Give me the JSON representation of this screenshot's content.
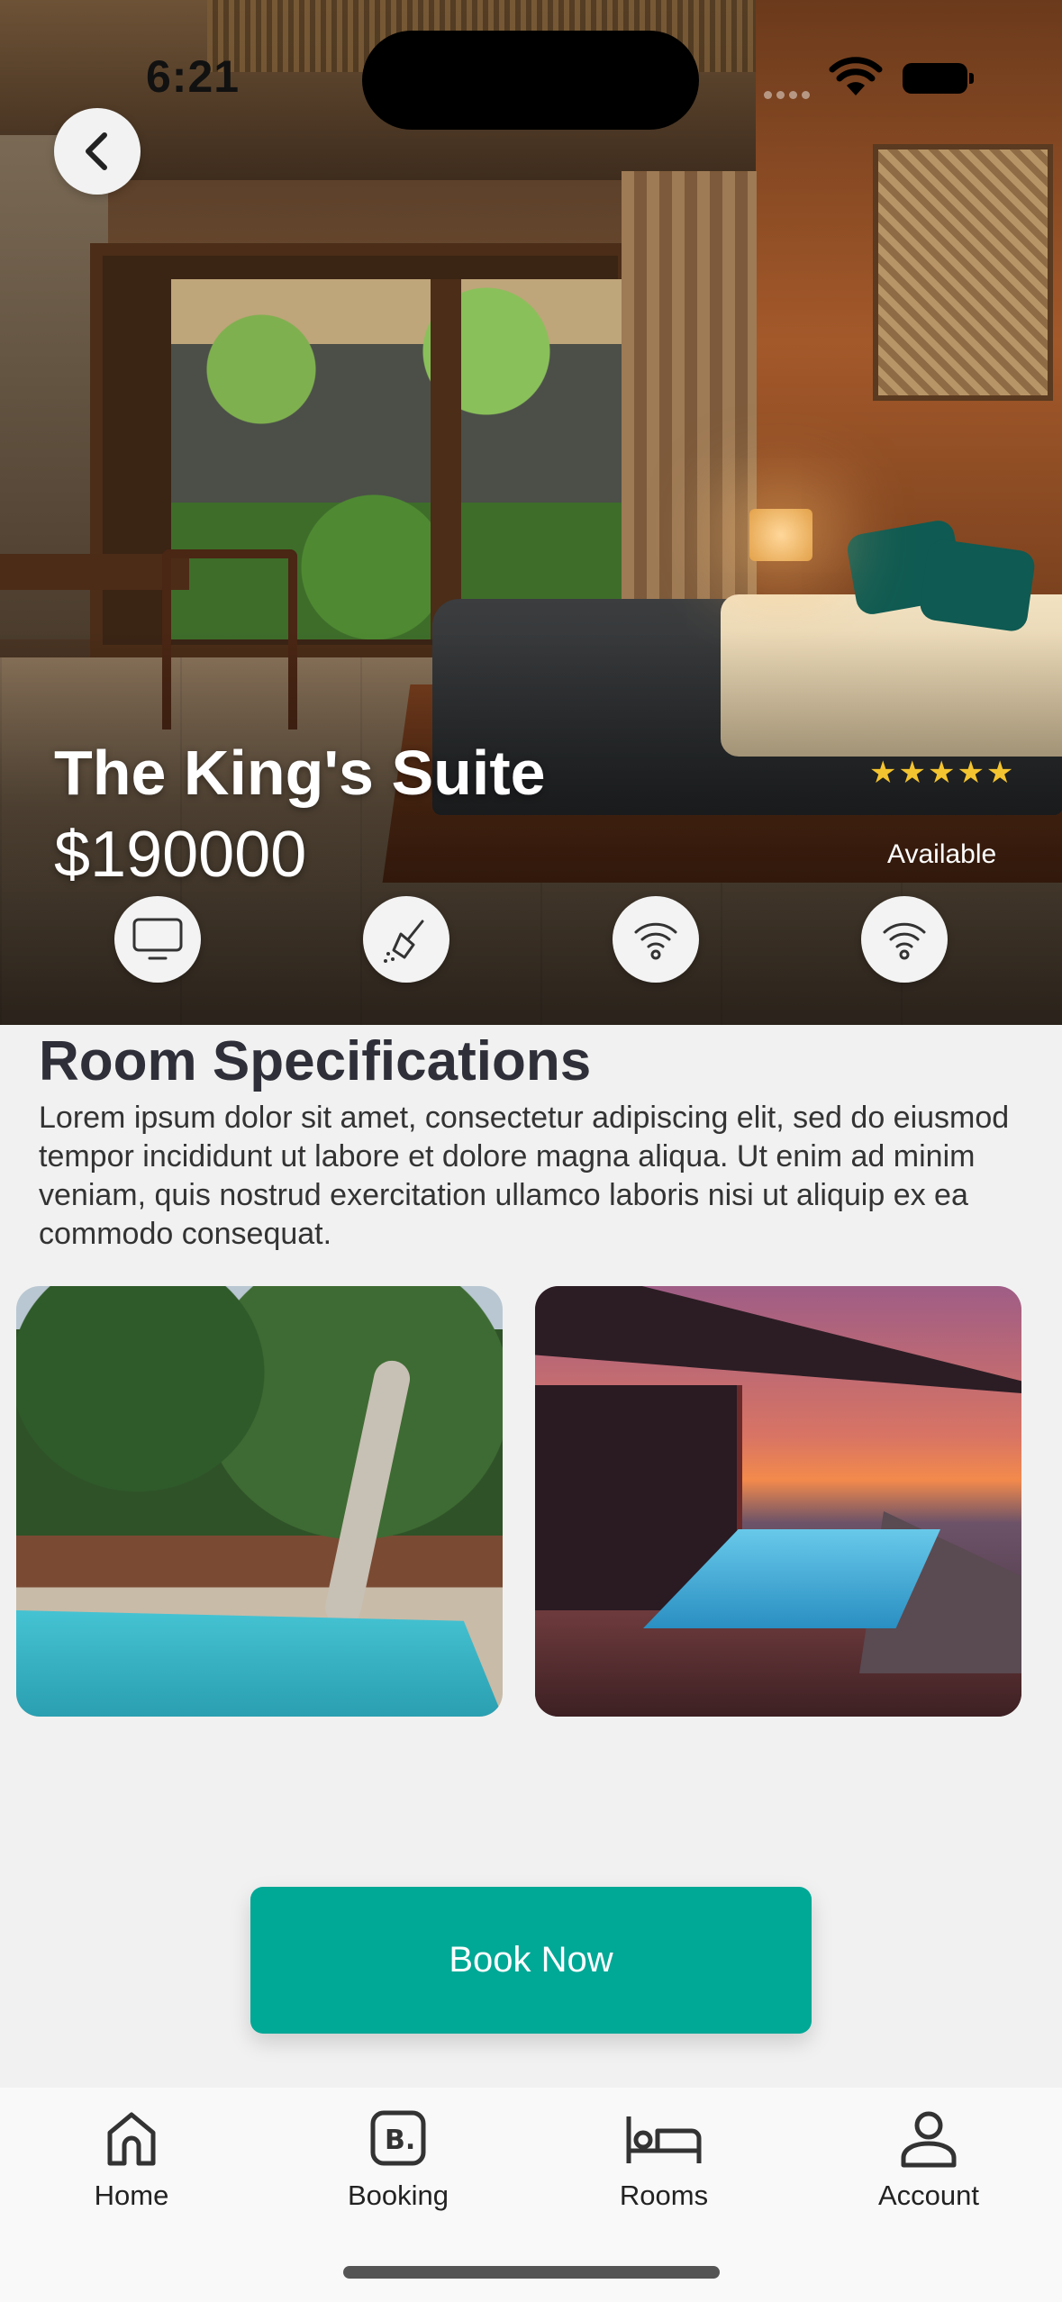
{
  "status_bar": {
    "time": "6:21"
  },
  "room": {
    "name": "The King's Suite",
    "price": "$190000",
    "rating": "★★★★★",
    "availability": "Available"
  },
  "amenities": [
    {
      "icon": "monitor-icon"
    },
    {
      "icon": "cleaning-broom-icon"
    },
    {
      "icon": "wifi-icon"
    },
    {
      "icon": "wifi-icon"
    }
  ],
  "specs": {
    "title": "Room Specifications",
    "body": "Lorem ipsum dolor sit amet, consectetur adipiscing elit, sed do eiusmod tempor incididunt ut labore et dolore magna aliqua. Ut enim ad minim veniam, quis nostrud exercitation ullamco laboris nisi ut aliquip ex ea commodo consequat."
  },
  "book_button": {
    "label": "Book Now"
  },
  "colors": {
    "accent": "#00a896",
    "star": "#f4c430"
  },
  "tabs": [
    {
      "label": "Home",
      "icon": "home-icon"
    },
    {
      "label": "Booking",
      "icon": "booking-icon"
    },
    {
      "label": "Rooms",
      "icon": "bed-icon"
    },
    {
      "label": "Account",
      "icon": "account-icon"
    }
  ]
}
